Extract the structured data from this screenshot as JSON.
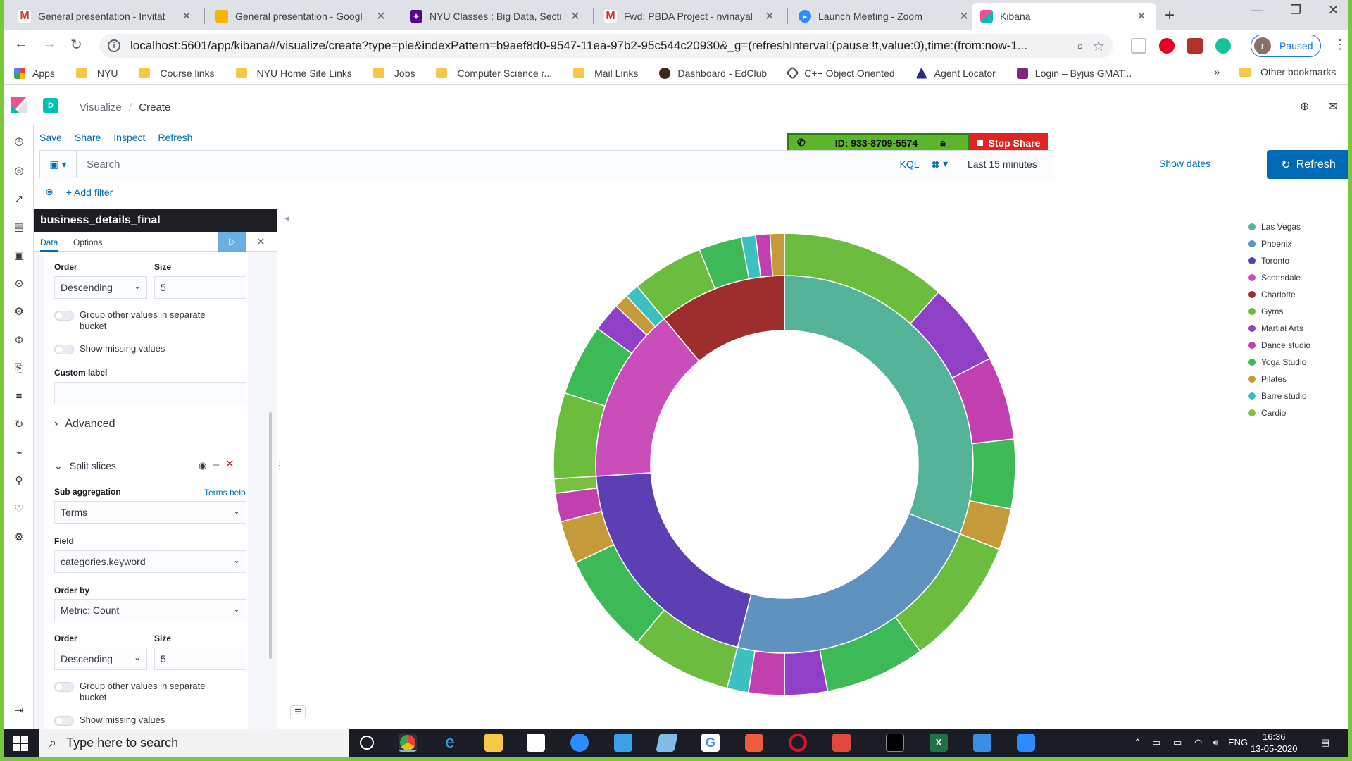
{
  "browser": {
    "tabs": [
      {
        "title": "General presentation - Invitat",
        "icon": "gmail-icon",
        "color": "#d93025"
      },
      {
        "title": "General presentation - Googl",
        "icon": "slides-icon",
        "color": "#f4b400"
      },
      {
        "title": "NYU Classes : Big Data, Secti",
        "icon": "nyu-icon",
        "color": "#57068c"
      },
      {
        "title": "Fwd: PBDA Project - nvinayal",
        "icon": "gmail-icon",
        "color": "#d93025"
      },
      {
        "title": "Launch Meeting - Zoom",
        "icon": "zoom-icon",
        "color": "#2d8cff"
      },
      {
        "title": "Kibana",
        "icon": "kibana-icon",
        "color": "#e8478b"
      }
    ],
    "url": "localhost:5601/app/kibana#/visualize/create?type=pie&indexPattern=b9aef8d0-9547-11ea-97b2-95c544c20930&_g=(refreshInterval:(pause:!t,value:0),time:(from:now-1...",
    "profile": {
      "initial": "r",
      "status": "Paused"
    },
    "bookmarks": [
      {
        "label": "Apps",
        "kind": "apps"
      },
      {
        "label": "NYU",
        "kind": "folder"
      },
      {
        "label": "Course links",
        "kind": "folder"
      },
      {
        "label": "NYU Home Site Links",
        "kind": "folder"
      },
      {
        "label": "Jobs",
        "kind": "folder"
      },
      {
        "label": "Computer Science r...",
        "kind": "folder"
      },
      {
        "label": "Mail Links",
        "kind": "folder"
      },
      {
        "label": "Dashboard - EdClub",
        "kind": "site"
      },
      {
        "label": "C++ Object Oriented",
        "kind": "site"
      },
      {
        "label": "Agent Locator",
        "kind": "site"
      },
      {
        "label": "Login – Byjus GMAT...",
        "kind": "site"
      }
    ],
    "bookmarks_more": "»",
    "other_bookmarks": "Other bookmarks"
  },
  "kibana": {
    "space": "D",
    "breadcrumb": {
      "parent": "Visualize",
      "current": "Create"
    },
    "top_menu": [
      "Save",
      "Share",
      "Inspect",
      "Refresh"
    ],
    "search_placeholder": "Search",
    "kql": "KQL",
    "time_range": "Last 15 minutes",
    "show_dates": "Show dates",
    "refresh_button": "Refresh",
    "add_filter": "+ Add filter"
  },
  "zoom_banner": {
    "meeting_id": "ID: 933-8709-5574",
    "stop_share": "Stop Share"
  },
  "editor": {
    "index_pattern": "business_details_final",
    "tabs": [
      "Data",
      "Options"
    ],
    "bucket1": {
      "order_label": "Order",
      "order_value": "Descending",
      "size_label": "Size",
      "size_value": "5",
      "group_other": "Group other values in separate bucket",
      "show_missing": "Show missing values",
      "custom_label": "Custom label",
      "advanced": "Advanced"
    },
    "split": {
      "title": "Split slices",
      "sub_agg_label": "Sub aggregation",
      "terms_help": "Terms help",
      "sub_agg_value": "Terms",
      "field_label": "Field",
      "field_value": "categories.keyword",
      "order_by_label": "Order by",
      "order_by_value": "Metric: Count",
      "order_label": "Order",
      "order_value": "Descending",
      "size_label": "Size",
      "size_value": "5",
      "group_other": "Group other values in separate bucket",
      "show_missing": "Show missing values"
    }
  },
  "chart_data": {
    "type": "pie",
    "donut": true,
    "inner_ring": {
      "categories": [
        "Las Vegas",
        "Phoenix",
        "Toronto",
        "Scottsdale",
        "Charlotte"
      ],
      "values": [
        31,
        23,
        20,
        15,
        11
      ]
    },
    "outer_ring": [
      {
        "city": "Las Vegas",
        "values": [
          {
            "category": "Gyms",
            "value": 12
          },
          {
            "category": "Martial Arts",
            "value": 6
          },
          {
            "category": "Dance studio",
            "value": 6
          },
          {
            "category": "Yoga Studio",
            "value": 5
          },
          {
            "category": "Pilates",
            "value": 3
          }
        ]
      },
      {
        "city": "Phoenix",
        "values": [
          {
            "category": "Gyms",
            "value": 9
          },
          {
            "category": "Yoga Studio",
            "value": 7
          },
          {
            "category": "Martial Arts",
            "value": 3
          },
          {
            "category": "Dance studio",
            "value": 2.5
          },
          {
            "category": "Barre studio",
            "value": 1.5
          }
        ]
      },
      {
        "city": "Toronto",
        "values": [
          {
            "category": "Gyms",
            "value": 7
          },
          {
            "category": "Yoga Studio",
            "value": 7
          },
          {
            "category": "Pilates",
            "value": 3
          },
          {
            "category": "Dance studio",
            "value": 2
          },
          {
            "category": "Cardio",
            "value": 1
          }
        ]
      },
      {
        "city": "Scottsdale",
        "values": [
          {
            "category": "Gyms",
            "value": 6
          },
          {
            "category": "Yoga Studio",
            "value": 5
          },
          {
            "category": "Martial Arts",
            "value": 2
          },
          {
            "category": "Pilates",
            "value": 1
          },
          {
            "category": "Barre studio",
            "value": 1
          }
        ]
      },
      {
        "city": "Charlotte",
        "values": [
          {
            "category": "Gyms",
            "value": 5
          },
          {
            "category": "Yoga Studio",
            "value": 3
          },
          {
            "category": "Barre studio",
            "value": 1
          },
          {
            "category": "Dance studio",
            "value": 1
          },
          {
            "category": "Pilates",
            "value": 1
          }
        ]
      }
    ],
    "legend": [
      {
        "label": "Las Vegas",
        "color": "#54b399"
      },
      {
        "label": "Phoenix",
        "color": "#6092c0"
      },
      {
        "label": "Toronto",
        "color": "#5c3fb3"
      },
      {
        "label": "Scottsdale",
        "color": "#ca4eb9"
      },
      {
        "label": "Charlotte",
        "color": "#9e2e2e"
      },
      {
        "label": "Gyms",
        "color": "#6cbd3f"
      },
      {
        "label": "Martial Arts",
        "color": "#9040c6"
      },
      {
        "label": "Dance studio",
        "color": "#c23fb0"
      },
      {
        "label": "Yoga Studio",
        "color": "#3db957"
      },
      {
        "label": "Pilates",
        "color": "#c49a3a"
      },
      {
        "label": "Barre studio",
        "color": "#3cc0c0"
      },
      {
        "label": "Cardio",
        "color": "#7ac143"
      }
    ],
    "legend_position": "right"
  },
  "taskbar": {
    "search_placeholder": "Type here to search",
    "lang": "ENG",
    "time": "16:36",
    "date": "13-05-2020"
  }
}
